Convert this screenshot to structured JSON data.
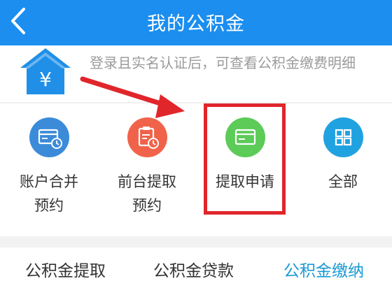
{
  "header": {
    "title": "我的公积金"
  },
  "banner": {
    "hint": "登录且实名认证后，可查看公积金缴费明细",
    "house_symbol": "¥"
  },
  "services": [
    {
      "line1": "账户合并",
      "line2": "预约",
      "icon": "account-card-icon",
      "color": "#3b8bd9"
    },
    {
      "line1": "前台提取",
      "line2": "预约",
      "icon": "clipboard-clock-icon",
      "color": "#f0634a"
    },
    {
      "line1": "提取申请",
      "line2": "",
      "icon": "card-icon",
      "color": "#5ccb58"
    },
    {
      "line1": "全部",
      "line2": "",
      "icon": "grid-icon",
      "color": "#21a2e0"
    }
  ],
  "tabs": [
    {
      "label": "公积金提取",
      "active": false
    },
    {
      "label": "公积金贷款",
      "active": false
    },
    {
      "label": "公积金缴纳",
      "active": true
    }
  ],
  "colors": {
    "header": "#1b8ef0",
    "annotation": "#e0262b",
    "active_tab": "#1a9ad6",
    "text": "#333333"
  }
}
